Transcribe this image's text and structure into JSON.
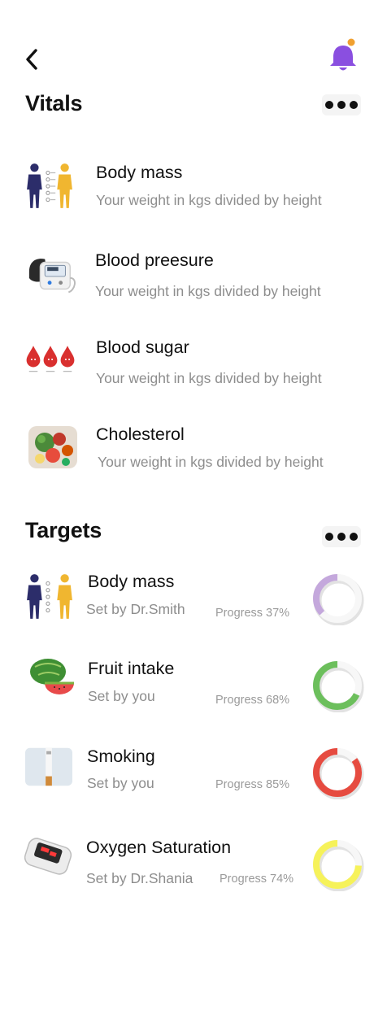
{
  "header": {
    "back_icon": "chevron-left-icon",
    "notification_icon": "bell-icon",
    "notification_color": "#8a4fe0",
    "badge_color": "#f0a030"
  },
  "vitals": {
    "title": "Vitals",
    "items": [
      {
        "title": "Body mass",
        "subtitle": "Your  weight in kgs  divided by height",
        "icon": "body-figure-icon"
      },
      {
        "title": "Blood preesure",
        "subtitle": "Your  weight in kgs  divided by height",
        "icon": "blood-pressure-monitor-icon"
      },
      {
        "title": "Blood sugar",
        "subtitle": "Your  weight in kgs  divided by height",
        "icon": "blood-drops-icon"
      },
      {
        "title": "Cholesterol",
        "subtitle": "Your  weight in kgs  divided by height",
        "icon": "healthy-food-icon"
      }
    ]
  },
  "targets": {
    "title": "Targets",
    "items": [
      {
        "title": "Body mass",
        "subtitle": "Set by Dr.Smith",
        "progress_label": "Progress 37%",
        "progress": 0.37,
        "color": "#c4a8dc",
        "icon": "body-figure-icon"
      },
      {
        "title": "Fruit intake",
        "subtitle": "Set by you",
        "progress_label": "Progress 68%",
        "progress": 0.68,
        "color": "#6cbf5c",
        "icon": "watermelon-icon"
      },
      {
        "title": "Smoking",
        "subtitle": "Set by you",
        "progress_label": "Progress 85%",
        "progress": 0.85,
        "color": "#e64b40",
        "icon": "cigarette-icon"
      },
      {
        "title": "Oxygen Saturation",
        "subtitle": "Set by Dr.Shania",
        "progress_label": "Progress 74%",
        "progress": 0.74,
        "color": "#f6f25a",
        "icon": "pulse-oximeter-icon"
      }
    ]
  }
}
